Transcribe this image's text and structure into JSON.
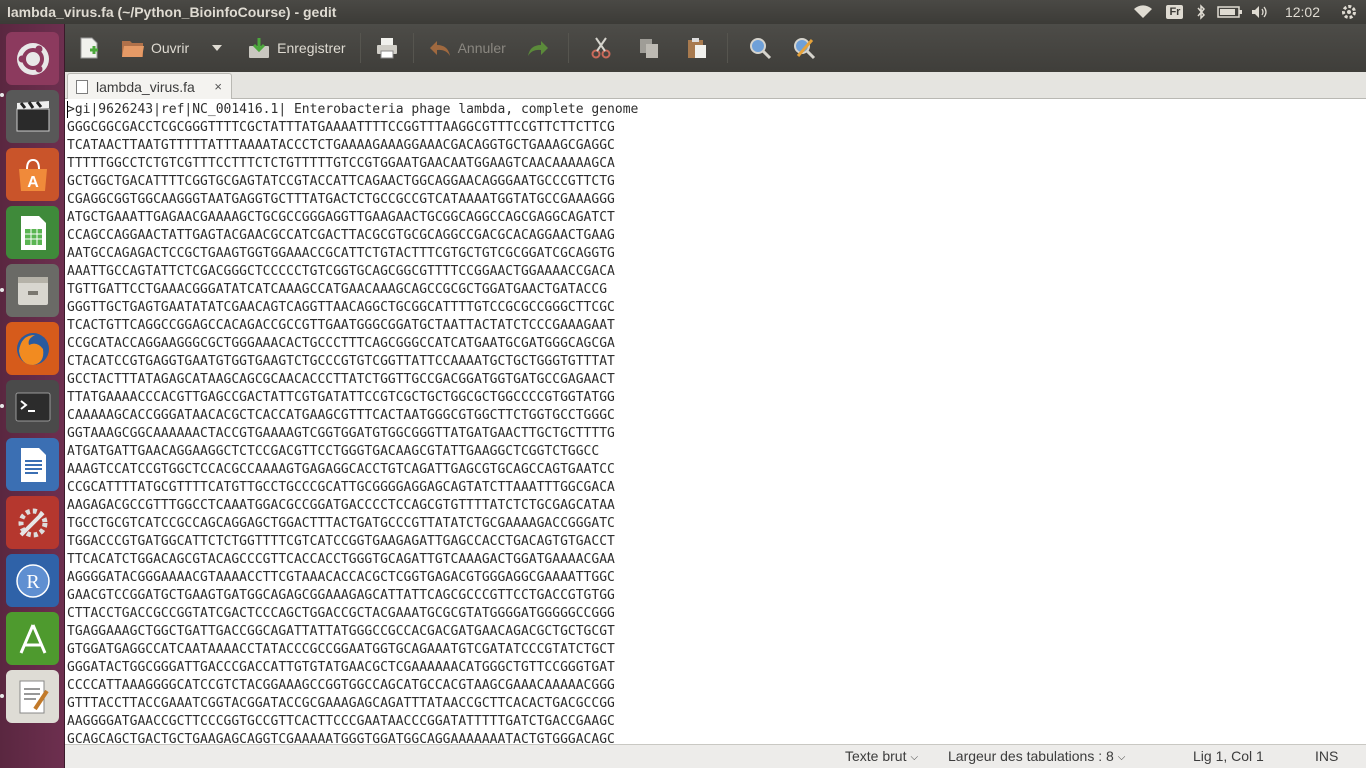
{
  "window_title": "lambda_virus.fa (~/Python_BioinfoCourse) - gedit",
  "indicators": {
    "keyboard_layout": "Fr",
    "clock": "12:02"
  },
  "launcher": [
    {
      "name": "ubuntu-dash-icon"
    },
    {
      "name": "openshot-icon"
    },
    {
      "name": "software-center-icon"
    },
    {
      "name": "libreoffice-calc-icon"
    },
    {
      "name": "files-icon"
    },
    {
      "name": "firefox-icon"
    },
    {
      "name": "terminal-icon"
    },
    {
      "name": "libreoffice-writer-icon"
    },
    {
      "name": "system-settings-icon"
    },
    {
      "name": "rstudio-icon",
      "letter": "R"
    },
    {
      "name": "android-studio-icon"
    },
    {
      "name": "text-editor-icon"
    }
  ],
  "toolbar": {
    "open_label": "Ouvrir",
    "save_label": "Enregistrer",
    "undo_label": "Annuler"
  },
  "tab": {
    "label": "lambda_virus.fa",
    "close": "×"
  },
  "document": {
    "lines": [
      ">gi|9626243|ref|NC_001416.1| Enterobacteria phage lambda, complete genome",
      "GGGCGGCGACCTCGCGGGTTTTCGCTATTTATGAAAATTTTCCGGTTTAAGGCGTTTCCGTTCTTCTTCG",
      "TCATAACTTAATGTTTTTATTTAAAATACCCTCTGAAAAGAAAGGAAACGACAGGTGCTGAAAGCGAGGC",
      "TTTTTGGCCTCTGTCGTTTCCTTTCTCTGTTTTTGTCCGTGGAATGAACAATGGAAGTCAACAAAAAGCA",
      "GCTGGCTGACATTTTCGGTGCGAGTATCCGTACCATTCAGAACTGGCAGGAACAGGGAATGCCCGTTCTG",
      "CGAGGCGGTGGCAAGGGTAATGAGGTGCTTTATGACTCTGCCGCCGTCATAAAATGGTATGCCGAAAGGG",
      "ATGCTGAAATTGAGAACGAAAAGCTGCGCCGGGAGGTTGAAGAACTGCGGCAGGCCAGCGAGGCAGATCT",
      "CCAGCCAGGAACTATTGAGTACGAACGCCATCGACTTACGCGTGCGCAGGCCGACGCACAGGAACTGAAG",
      "AATGCCAGAGACTCCGCTGAAGTGGTGGAAACCGCATTCTGTACTTTCGTGCTGTCGCGGATCGCAGGTG",
      "AAATTGCCAGTATTCTCGACGGGCTCCCCCTGTCGGTGCAGCGGCGTTTTCCGGAACTGGAAAACCGACA",
      "TGTTGATTCCTGAAACGGGATATCATCAAAGCCATGAACAAAGCAGCCGCGCTGGATGAACTGATACCG",
      "GGGTTGCTGAGTGAATATATCGAACAGTCAGGTTAACAGGCTGCGGCATTTTGTCCGCGCCGGGCTTCGC",
      "TCACTGTTCAGGCCGGAGCCACAGACCGCCGTTGAATGGGCGGATGCTAATTACTATCTCCCGAAAGAAT",
      "CCGCATACCAGGAAGGGCGCTGGGAAACACTGCCCTTTCAGCGGGCCATCATGAATGCGATGGGCAGCGA",
      "CTACATCCGTGAGGTGAATGTGGTGAAGTCTGCCCGTGTCGGTTATTCCAAAATGCTGCTGGGTGTTTAT",
      "GCCTACTTTATAGAGCATAAGCAGCGCAACACCCTTATCTGGTTGCCGACGGATGGTGATGCCGAGAACT",
      "TTATGAAAACCCACGTTGAGCCGACTATTCGTGATATTCCGTCGCTGCTGGCGCTGGCCCCGTGGTATGG",
      "CAAAAAGCACCGGGATAACACGCTCACCATGAAGCGTTTCACTAATGGGCGTGGCTTCTGGTGCCTGGGC",
      "GGTAAAGCGGCAAAAAACTACCGTGAAAAGTCGGTGGATGTGGCGGGTTATGATGAACTTGCTGCTTTTG",
      "ATGATGATTGAACAGGAAGGCTCTCCGACGTTCCTGGGTGACAAGCGTATTGAAGGCTCGGTCTGGCC",
      "AAAGTCCATCCGTGGCTCCACGCCAAAAGTGAGAGGCACCTGTCAGATTGAGCGTGCAGCCAGTGAATCC",
      "CCGCATTTTATGCGTTTTCATGTTGCCTGCCCGCATTGCGGGGAGGAGCAGTATCTTAAATTTGGCGACA",
      "AAGAGACGCCGTTTGGCCTCAAATGGACGCCGGATGACCCCTCCAGCGTGTTTTATCTCTGCGAGCATAA",
      "TGCCTGCGTCATCCGCCAGCAGGAGCTGGACTTTACTGATGCCCGTTATATCTGCGAAAAGACCGGGATC",
      "TGGACCCGTGATGGCATTCTCTGGTTTTCGTCATCCGGTGAAGAGATTGAGCCACCTGACAGTGTGACCT",
      "TTCACATCTGGACAGCGTACAGCCCGTTCACCACCTGGGTGCAGATTGTCAAAGACTGGATGAAAACGAA",
      "AGGGGATACGGGAAAACGTAAAACCTTCGTAAACACCACGCTCGGTGAGACGTGGGAGGCGAAAATTGGC",
      "GAACGTCCGGATGCTGAAGTGATGGCAGAGCGGAAAGAGCATTATTCAGCGCCCGTTCCTGACCGTGTGG",
      "CTTACCTGACCGCCGGTATCGACTCCCAGCTGGACCGCTACGAAATGCGCGTATGGGGATGGGGGCCGGG",
      "TGAGGAAAGCTGGCTGATTGACCGGCAGATTATTATGGGCCGCCACGACGATGAACAGACGCTGCTGCGT",
      "GTGGATGAGGCCATCAATAAAACCTATACCCGCCGGAATGGTGCAGAAATGTCGATATCCCGTATCTGCT",
      "GGGATACTGGCGGGATTGACCCGACCATTGTGTATGAACGCTCGAAAAAACATGGGCTGTTCCGGGTGAT",
      "CCCCATTAAAGGGGCATCCGTCTACGGAAAGCCGGTGGCCAGCATGCCACGTAAGCGAAACAAAAACGGG",
      "GTTTACCTTACCGAAATCGGTACGGATACCGCGAAAGAGCAGATTTATAACCGCTTCACACTGACGCCGG",
      "AAGGGGATGAACCGCTTCCCGGTGCCGTTCACTTCCCGAATAACCCGGATATTTTTGATCTGACCGAAGC",
      "GCAGCAGCTGACTGCTGAAGAGCAGGTCGAAAAATGGGTGGATGGCAGGAAAAAAATACTGTGGGACAGC"
    ]
  },
  "statusbar": {
    "language": "Texte brut",
    "tab_width": "Largeur des tabulations : 8",
    "position": "Lig 1, Col 1",
    "mode": "INS"
  }
}
